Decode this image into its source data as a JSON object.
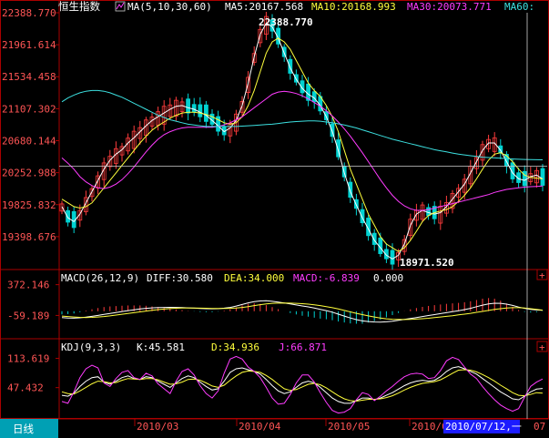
{
  "colors": {
    "background": "#000000",
    "frame": "#aa0000",
    "up": "#ff3c3c",
    "down": "#00d2d2",
    "axis_label": "#ff5555",
    "ma5": "#ffffff",
    "ma10": "#ffff3c",
    "ma30": "#ff3cff",
    "ma60": "#3ce0e0",
    "white": "#ffffff",
    "crosshair": "#cfcfcf",
    "tab_bg": "#00a0b4",
    "date_highlight": "#1c1cff"
  },
  "header": {
    "instrument": "恒生指数",
    "ma_label": "MA(5,10,30,60)",
    "ma5": "MA5:20167.568",
    "ma10": "MA10:20168.993",
    "ma30": "MA30:20073.771",
    "ma60": "MA60:"
  },
  "macd_header": {
    "label": "MACD(26,12,9)",
    "diff": "DIFF:30.580",
    "dea": "DEA:34.000",
    "macd": "MACD:-6.839",
    "extra": "0.000"
  },
  "kdj_header": {
    "label": "KDJ(9,3,3)",
    "k": "K:45.581",
    "d": "D:34.936",
    "j": "J:66.871"
  },
  "bottom_bar": {
    "period_tab": "日线",
    "dates": [
      "2010/03",
      "2010/04",
      "2010/05",
      "2010/06"
    ],
    "cursor_date": "2010/07/12,一",
    "cursor_tail": "07"
  },
  "annotations": {
    "high": "22388.770",
    "low": "18971.520"
  },
  "chart_data": [
    {
      "type": "candlestick",
      "title": "恒生指数",
      "y_ticks": [
        "22388.770",
        "21961.614",
        "21534.458",
        "21107.302",
        "20680.144",
        "20252.988",
        "19825.832",
        "19398.676"
      ],
      "ylim": [
        18971.52,
        22388.77
      ],
      "crosshair_y": 20340,
      "series": [
        {
          "name": "MA5",
          "values": [
            19800,
            19650,
            19600,
            19700,
            19850,
            20000,
            20150,
            20300,
            20420,
            20500,
            20560,
            20650,
            20720,
            20800,
            20880,
            20950,
            21000,
            21050,
            21100,
            21140,
            21150,
            21120,
            21100,
            21060,
            21020,
            20950,
            20880,
            20800,
            20850,
            20950,
            21150,
            21450,
            21800,
            22100,
            22250,
            22200,
            22050,
            21850,
            21650,
            21500,
            21380,
            21300,
            21250,
            21150,
            21000,
            20800,
            20550,
            20250,
            20000,
            19820,
            19650,
            19500,
            19350,
            19250,
            19150,
            19100,
            19150,
            19300,
            19550,
            19700,
            19750,
            19720,
            19700,
            19720,
            19800,
            19900,
            20000,
            20100,
            20250,
            20400,
            20550,
            20650,
            20650,
            20550,
            20400,
            20250,
            20170,
            20150,
            20200,
            20220,
            20168
          ]
        },
        {
          "name": "MA10",
          "values": [
            19900,
            19850,
            19800,
            19780,
            19800,
            19850,
            19950,
            20050,
            20150,
            20250,
            20350,
            20450,
            20550,
            20650,
            20740,
            20820,
            20880,
            20930,
            20980,
            21020,
            21050,
            21060,
            21060,
            21050,
            21030,
            21000,
            20960,
            20920,
            20900,
            20920,
            21000,
            21150,
            21350,
            21600,
            21850,
            22000,
            22050,
            22000,
            21900,
            21750,
            21600,
            21450,
            21350,
            21270,
            21150,
            21000,
            20800,
            20550,
            20300,
            20100,
            19900,
            19700,
            19550,
            19400,
            19300,
            19250,
            19200,
            19250,
            19350,
            19470,
            19600,
            19680,
            19720,
            19740,
            19760,
            19800,
            19870,
            19950,
            20050,
            20170,
            20300,
            20420,
            20500,
            20520,
            20480,
            20400,
            20300,
            20220,
            20190,
            20180,
            20169
          ]
        },
        {
          "name": "MA30",
          "values": [
            20450,
            20380,
            20300,
            20200,
            20130,
            20080,
            20050,
            20040,
            20060,
            20100,
            20160,
            20240,
            20330,
            20430,
            20530,
            20620,
            20700,
            20760,
            20800,
            20830,
            20850,
            20860,
            20860,
            20860,
            20860,
            20860,
            20870,
            20890,
            20920,
            20960,
            21000,
            21060,
            21120,
            21180,
            21240,
            21300,
            21330,
            21340,
            21330,
            21310,
            21280,
            21240,
            21190,
            21140,
            21080,
            21010,
            20930,
            20840,
            20740,
            20630,
            20520,
            20400,
            20280,
            20160,
            20050,
            19950,
            19870,
            19810,
            19770,
            19750,
            19750,
            19760,
            19780,
            19800,
            19820,
            19840,
            19860,
            19880,
            19900,
            19920,
            19940,
            19960,
            19990,
            20010,
            20030,
            20040,
            20050,
            20060,
            20066,
            20070,
            20074
          ]
        },
        {
          "name": "MA60",
          "values": [
            21200,
            21250,
            21290,
            21320,
            21340,
            21350,
            21350,
            21340,
            21320,
            21290,
            21260,
            21220,
            21180,
            21140,
            21100,
            21060,
            21020,
            20990,
            20960,
            20940,
            20920,
            20900,
            20890,
            20880,
            20870,
            20870,
            20870,
            20870,
            20870,
            20870,
            20875,
            20880,
            20885,
            20890,
            20895,
            20900,
            20910,
            20920,
            20930,
            20935,
            20940,
            20945,
            20945,
            20940,
            20930,
            20920,
            20905,
            20890,
            20870,
            20850,
            20825,
            20800,
            20775,
            20750,
            20725,
            20700,
            20680,
            20660,
            20640,
            20620,
            20600,
            20580,
            20560,
            20545,
            20530,
            20515,
            20500,
            20490,
            20480,
            20470,
            20460,
            20455,
            20450,
            20445,
            20440,
            20436,
            20432,
            20430,
            20428,
            20426,
            20425
          ]
        }
      ],
      "high_label_value": 22388.77,
      "low_label_value": 18971.52
    },
    {
      "type": "bar",
      "title": "MACD(26,12,9)",
      "y_ticks": [
        "372.146",
        "-59.189"
      ],
      "ylim": [
        -360,
        380
      ],
      "series": [
        {
          "name": "DIFF",
          "values": [
            -200,
            -210,
            -215,
            -205,
            -185,
            -160,
            -130,
            -100,
            -70,
            -40,
            -10,
            20,
            45,
            70,
            90,
            105,
            115,
            120,
            122,
            120,
            115,
            105,
            95,
            85,
            78,
            75,
            80,
            95,
            120,
            160,
            210,
            260,
            300,
            320,
            325,
            310,
            285,
            255,
            225,
            195,
            165,
            135,
            100,
            60,
            20,
            -30,
            -90,
            -150,
            -210,
            -260,
            -300,
            -320,
            -335,
            -340,
            -330,
            -310,
            -285,
            -255,
            -225,
            -195,
            -165,
            -135,
            -105,
            -75,
            -45,
            -15,
            15,
            50,
            90,
            140,
            190,
            230,
            250,
            245,
            220,
            180,
            130,
            90,
            60,
            40,
            30.58
          ]
        },
        {
          "name": "DEA",
          "values": [
            -150,
            -165,
            -180,
            -190,
            -195,
            -190,
            -180,
            -165,
            -145,
            -120,
            -95,
            -70,
            -45,
            -20,
            5,
            30,
            50,
            68,
            82,
            92,
            98,
            100,
            99,
            96,
            92,
            88,
            85,
            85,
            90,
            100,
            120,
            145,
            175,
            205,
            230,
            245,
            253,
            255,
            252,
            245,
            235,
            220,
            200,
            175,
            145,
            110,
            70,
            25,
            -20,
            -65,
            -105,
            -145,
            -180,
            -210,
            -235,
            -250,
            -257,
            -258,
            -254,
            -245,
            -233,
            -218,
            -200,
            -180,
            -160,
            -138,
            -115,
            -90,
            -65,
            -35,
            -5,
            25,
            55,
            80,
            100,
            110,
            110,
            100,
            80,
            55,
            34
          ]
        },
        {
          "name": "MACD",
          "values": [
            -100,
            -90,
            -70,
            -30,
            20,
            60,
            100,
            130,
            150,
            160,
            170,
            180,
            180,
            180,
            170,
            150,
            130,
            105,
            80,
            55,
            35,
            10,
            -8,
            -22,
            -28,
            -26,
            -10,
            20,
            60,
            120,
            180,
            230,
            250,
            230,
            190,
            130,
            65,
            0,
            -55,
            -100,
            -140,
            -170,
            -200,
            -230,
            -250,
            -280,
            -320,
            -350,
            -380,
            -390,
            -390,
            -350,
            -310,
            -260,
            -190,
            -120,
            -55,
            5,
            60,
            100,
            135,
            165,
            190,
            210,
            230,
            245,
            260,
            280,
            310,
            350,
            390,
            410,
            390,
            330,
            240,
            140,
            40,
            -20,
            -40,
            -30,
            -6.839
          ]
        }
      ]
    },
    {
      "type": "line",
      "title": "KDJ(9,3,3)",
      "y_ticks": [
        "113.619",
        "47.432"
      ],
      "ylim": [
        -15,
        125
      ],
      "series": [
        {
          "name": "K",
          "values": [
            30,
            28,
            35,
            50,
            62,
            70,
            72,
            60,
            55,
            62,
            70,
            74,
            68,
            66,
            72,
            70,
            62,
            55,
            48,
            58,
            68,
            74,
            70,
            60,
            50,
            42,
            45,
            62,
            82,
            90,
            92,
            88,
            84,
            78,
            66,
            52,
            40,
            34,
            38,
            48,
            58,
            62,
            58,
            48,
            36,
            24,
            16,
            12,
            12,
            18,
            24,
            24,
            20,
            24,
            30,
            36,
            44,
            52,
            58,
            62,
            64,
            62,
            64,
            72,
            84,
            92,
            95,
            90,
            84,
            78,
            68,
            58,
            48,
            38,
            30,
            22,
            20,
            28,
            38,
            44,
            45.581
          ]
        },
        {
          "name": "D",
          "values": [
            38,
            34,
            33,
            40,
            48,
            56,
            62,
            61,
            58,
            59,
            64,
            68,
            67,
            66,
            68,
            68,
            65,
            60,
            55,
            56,
            60,
            66,
            67,
            64,
            58,
            51,
            48,
            53,
            64,
            74,
            82,
            85,
            84,
            82,
            75,
            66,
            55,
            45,
            41,
            43,
            49,
            55,
            57,
            54,
            47,
            38,
            29,
            22,
            18,
            17,
            19,
            21,
            21,
            22,
            25,
            29,
            35,
            42,
            48,
            53,
            57,
            59,
            61,
            65,
            72,
            80,
            87,
            88,
            87,
            83,
            77,
            70,
            62,
            53,
            45,
            36,
            30,
            29,
            32,
            36,
            34.936
          ]
        },
        {
          "name": "J",
          "values": [
            16,
            12,
            38,
            70,
            90,
            98,
            92,
            58,
            50,
            68,
            82,
            86,
            70,
            66,
            80,
            74,
            56,
            45,
            34,
            62,
            84,
            90,
            76,
            52,
            34,
            24,
            40,
            80,
            112,
            118,
            112,
            94,
            84,
            70,
            48,
            24,
            10,
            12,
            32,
            58,
            76,
            76,
            60,
            36,
            14,
            -4,
            -10,
            -8,
            0,
            20,
            36,
            32,
            18,
            28,
            40,
            50,
            62,
            72,
            78,
            80,
            78,
            68,
            70,
            86,
            108,
            116,
            111,
            94,
            78,
            68,
            50,
            34,
            20,
            8,
            0,
            -6,
            0,
            26,
            50,
            60,
            66.871
          ]
        }
      ]
    }
  ]
}
